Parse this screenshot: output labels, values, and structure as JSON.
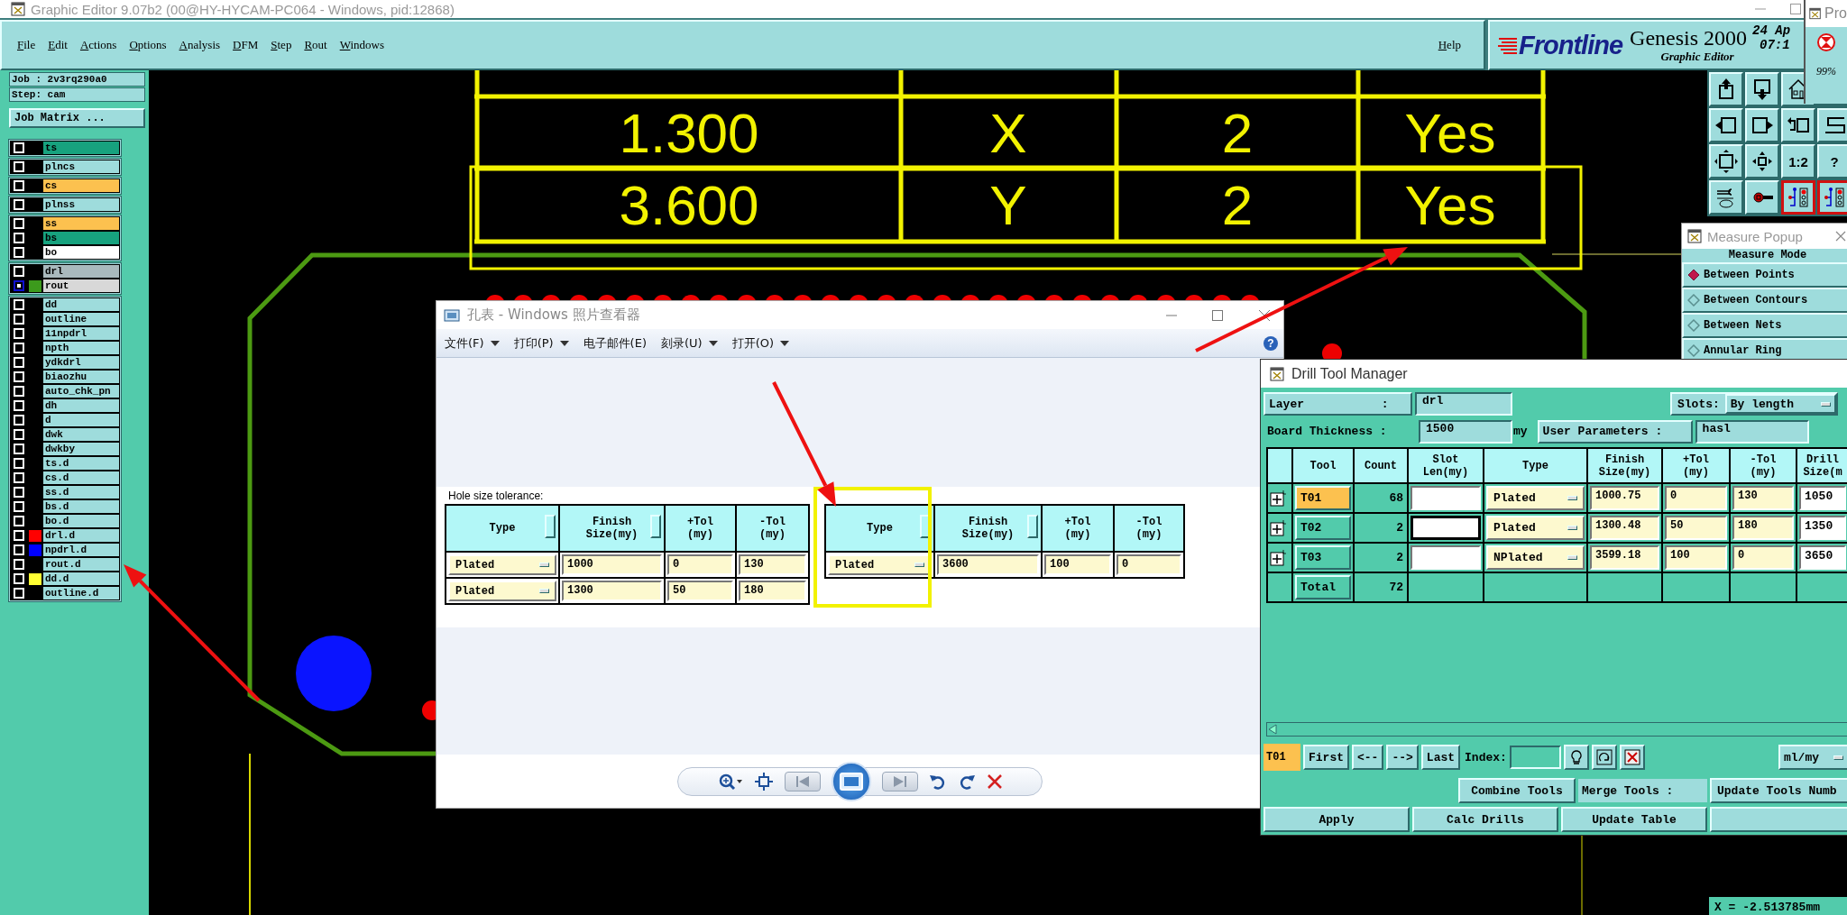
{
  "window": {
    "title": "Graphic Editor 9.07b2 (00@HY-HYCAM-PC064 - Windows, pid:12868)"
  },
  "menu": [
    "File",
    "Edit",
    "Actions",
    "Options",
    "Analysis",
    "DFM",
    "Step",
    "Rout",
    "Windows"
  ],
  "help_menu": "Help",
  "branding": {
    "logo": "Frontline",
    "product": "Genesis 2000",
    "subtitle": "Graphic Editor",
    "date": "24 Ap",
    "time": "07:1"
  },
  "progress_window": {
    "title": "Pro",
    "percent": "99%"
  },
  "job": {
    "job": "Job : 2v3rq290a0",
    "step": "Step: cam",
    "matrix_button": "Job Matrix ..."
  },
  "layer_groups": [
    [
      {
        "name": "ts",
        "color": "#17a27e",
        "work": false
      }
    ],
    [
      {
        "name": "plncs",
        "color": "#9edcdc",
        "work": false
      }
    ],
    [
      {
        "name": "cs",
        "color": "#fcc14f",
        "work": false
      }
    ],
    [
      {
        "name": "plnss",
        "color": "#9edcdc",
        "work": false
      }
    ],
    [
      {
        "name": "ss",
        "color": "#fcc14f",
        "work": false
      },
      {
        "name": "bs",
        "color": "#17a27e",
        "work": false
      },
      {
        "name": "bo",
        "color": "#ffffff",
        "work": false
      }
    ],
    [
      {
        "name": "drl",
        "color": "#a9b9bd",
        "work": false
      },
      {
        "name": "rout",
        "color": "#d8d8d8",
        "swatch": {
          "color": "#3c9a1c"
        },
        "work": true
      }
    ],
    [
      {
        "name": "dd",
        "color": "#9edcdc",
        "work": false
      },
      {
        "name": "outline",
        "color": "#9edcdc",
        "work": false
      },
      {
        "name": "11npdrl",
        "color": "#9edcdc",
        "work": false
      },
      {
        "name": "npth",
        "color": "#9edcdc",
        "work": false
      },
      {
        "name": "ydkdrl",
        "color": "#9edcdc",
        "work": false
      },
      {
        "name": "biaozhu",
        "color": "#9edcdc",
        "work": false
      },
      {
        "name": "auto_chk_pn",
        "color": "#9edcdc",
        "work": false
      },
      {
        "name": "dh",
        "color": "#9edcdc",
        "work": false
      },
      {
        "name": "d",
        "color": "#9edcdc",
        "work": false
      },
      {
        "name": "dwk",
        "color": "#9edcdc",
        "work": false
      },
      {
        "name": "dwkby",
        "color": "#9edcdc",
        "work": false
      },
      {
        "name": "ts.d",
        "color": "#9edcdc",
        "work": false
      },
      {
        "name": "cs.d",
        "color": "#9edcdc",
        "work": false
      },
      {
        "name": "ss.d",
        "color": "#9edcdc",
        "work": false
      },
      {
        "name": "bs.d",
        "color": "#9edcdc",
        "work": false
      },
      {
        "name": "bo.d",
        "color": "#9edcdc",
        "work": false
      },
      {
        "name": "drl.d",
        "color": "#9edcdc",
        "swatch": {
          "color": "#ff0000"
        },
        "work": false
      },
      {
        "name": "npdrl.d",
        "color": "#9edcdc",
        "swatch": {
          "color": "#0000ff"
        },
        "work": false
      },
      {
        "name": "rout.d",
        "color": "#9edcdc",
        "work": false
      },
      {
        "name": "dd.d",
        "color": "#9edcdc",
        "swatch": {
          "color": "#ffff33"
        },
        "work": false
      },
      {
        "name": "outline.d",
        "color": "#9edcdc",
        "work": false
      }
    ]
  ],
  "toolbar": {
    "text_buttons": [
      "1:2",
      "?"
    ],
    "toggles": [
      {
        "on": true
      },
      {
        "on": true
      }
    ]
  },
  "canvas_table": {
    "rows": [
      {
        "cells": [
          "1.300",
          "X",
          "2",
          "Yes"
        ],
        "highlighted": false
      },
      {
        "cells": [
          "3.600",
          "Y",
          "2",
          "Yes"
        ],
        "highlighted": true
      }
    ]
  },
  "measure_popup": {
    "title": "Measure Popup",
    "heading": "Measure Mode",
    "modes": [
      {
        "label": "Between Points",
        "selected": true
      },
      {
        "label": "Between Contours",
        "selected": false
      },
      {
        "label": "Between Nets",
        "selected": false
      },
      {
        "label": "Annular Ring",
        "selected": false
      }
    ]
  },
  "photo_viewer": {
    "title": "孔表 - Windows 照片查看器",
    "menu": [
      {
        "label": "文件(F)",
        "dropdown": true
      },
      {
        "label": "打印(P)",
        "dropdown": true
      },
      {
        "label": "电子邮件(E)",
        "dropdown": false
      },
      {
        "label": "刻录(U)",
        "dropdown": true
      },
      {
        "label": "打开(O)",
        "dropdown": true
      }
    ],
    "help": "?",
    "image": {
      "caption": "Hole size tolerance:",
      "tables": [
        {
          "columns": [
            "Type",
            "Finish\nSize(my)",
            "+Tol\n(my)",
            "-Tol\n(my)"
          ],
          "rows": [
            [
              "Plated",
              "1000",
              "0",
              "130"
            ],
            [
              "Plated",
              "1300",
              "50",
              "180"
            ]
          ],
          "highlighted": false
        },
        {
          "columns": [
            "Type",
            "Finish\nSize(my)",
            "+Tol\n(my)",
            "-Tol\n(my)"
          ],
          "rows": [
            [
              "Plated",
              "3600",
              "100",
              "0"
            ]
          ],
          "highlighted": true
        }
      ]
    }
  },
  "drill_tool_manager": {
    "title": "Drill Tool Manager",
    "layer_label": "Layer           :",
    "layer": "drl",
    "slots_label": "Slots:",
    "slots": "By length",
    "thickness_label": "Board Thickness :",
    "thickness": "1500",
    "thickness_unit": "my",
    "user_params_label": "User Parameters :",
    "user_params": "hasl",
    "columns": [
      "Tool",
      "Count",
      "Slot\nLen(my)",
      "Type",
      "Finish\nSize(my)",
      "+Tol\n(my)",
      "-Tol\n(my)",
      "Drill\nSize(m"
    ],
    "tools": [
      {
        "tool": "T01",
        "selected": true,
        "count": "68",
        "slot_focused": false,
        "type": "Plated",
        "finish": "1000.75",
        "plus_tol": "0",
        "minus_tol": "130",
        "drill": "1050"
      },
      {
        "tool": "T02",
        "selected": false,
        "count": "2",
        "slot_focused": true,
        "type": "Plated",
        "finish": "1300.48",
        "plus_tol": "50",
        "minus_tol": "180",
        "drill": "1350"
      },
      {
        "tool": "T03",
        "selected": false,
        "count": "2",
        "slot_focused": false,
        "type": "NPlated",
        "finish": "3599.18",
        "plus_tol": "100",
        "minus_tol": "0",
        "drill": "3650"
      }
    ],
    "total": {
      "label": "Total",
      "count": "72"
    },
    "current_tool": "T01",
    "nav_buttons": [
      "First",
      "<--",
      "-->",
      "Last"
    ],
    "index_label": "Index:",
    "units": "ml/my",
    "combine": "Combine Tools",
    "merge_label": "Merge Tools :",
    "update_numbers": "Update Tools Numb",
    "actions": [
      "Apply",
      "Calc Drills",
      "Update Table"
    ]
  },
  "coordinate_readout": "X = -2.513785mm"
}
